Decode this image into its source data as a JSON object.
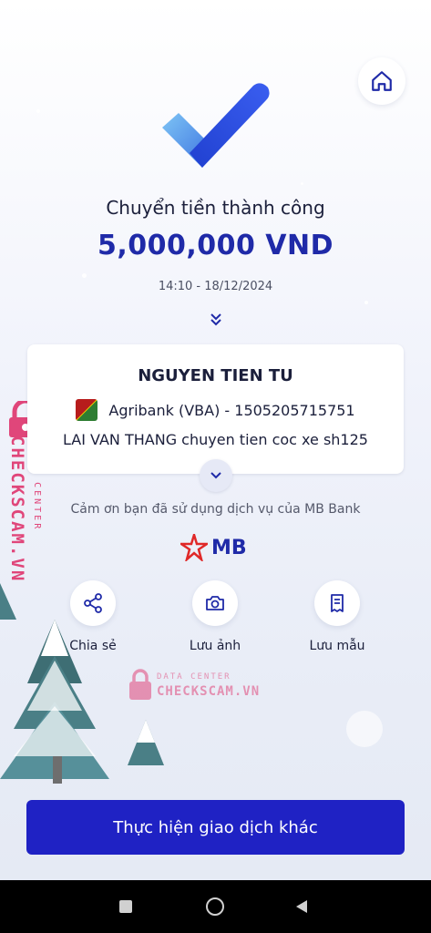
{
  "header": {
    "home_icon": "home-icon"
  },
  "status": {
    "title": "Chuyển tiền thành công",
    "amount": "5,000,000 VND",
    "datetime": "14:10 - 18/12/2024"
  },
  "receiver": {
    "name": "NGUYEN TIEN TU",
    "bank": "Agribank (VBA) - 1505205715751",
    "note": "LAI VAN THANG chuyen tien coc xe sh125"
  },
  "footer_text": {
    "thanks": "Cảm ơn bạn đã sử dụng dịch vụ của MB Bank",
    "brand": "MB"
  },
  "actions": [
    {
      "label": "Chia sẻ",
      "icon": "share-icon"
    },
    {
      "label": "Lưu ảnh",
      "icon": "camera-icon"
    },
    {
      "label": "Lưu mẫu",
      "icon": "receipt-icon"
    }
  ],
  "primary_button": {
    "label": "Thực hiện giao dịch khác"
  },
  "watermark": {
    "line1": "DATA CENTER",
    "line2": "CHECKSCAM.VN"
  },
  "colors": {
    "brand_blue": "#1f2aa8",
    "button_blue": "#1f22c4",
    "watermark_pink": "#e0467a"
  }
}
